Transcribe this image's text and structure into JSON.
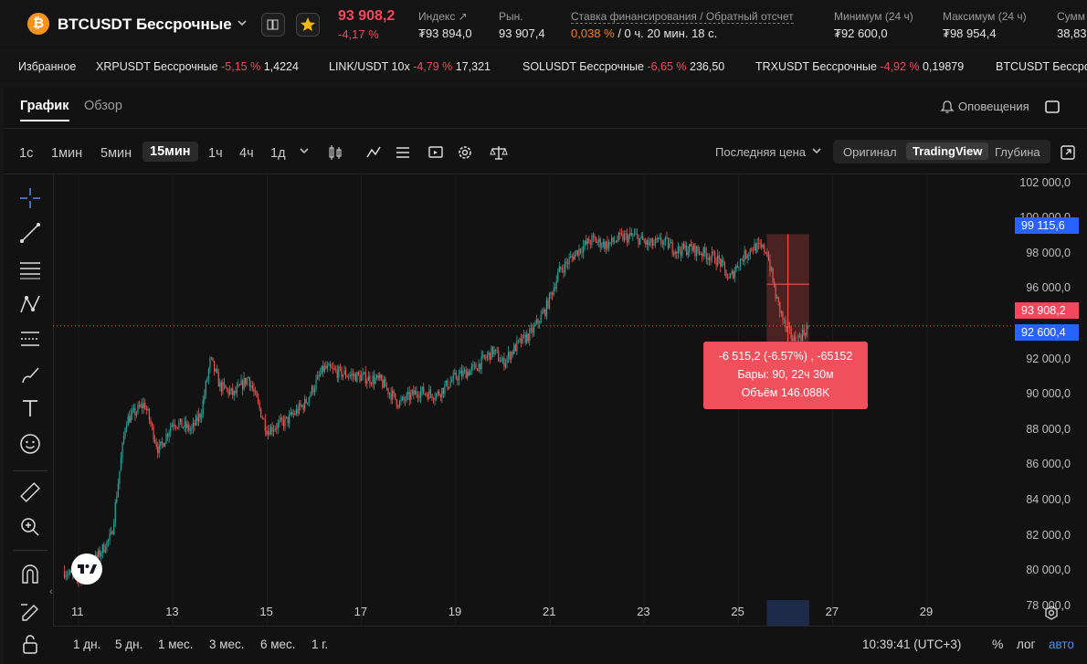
{
  "header": {
    "coin_glyph": "₿",
    "symbol": "BTCUSDT Бессрочные",
    "price": "93 908,2",
    "change": "-4,17 %",
    "index_label": "Индекс",
    "index_value": "₮93 894,0",
    "market_label": "Рын.",
    "market_value": "93 907,4",
    "funding_label": "Ставка финансирования / Обратный отсчет",
    "funding_rate": "0,038 %",
    "funding_countdown": "/ 0 ч. 20 мин. 18 с.",
    "min_label": "Минимум (24 ч)",
    "min_value": "₮92 600,0",
    "max_label": "Максимум (24 ч)",
    "max_value": "₮98 954,4",
    "sum_label": "Сумм",
    "sum_value": "38,83"
  },
  "ticker": {
    "favorites_label": "Избранное",
    "items": [
      {
        "name": "XRPUSDT Бессрочные",
        "change": "-5,15 %",
        "price": "1,4224"
      },
      {
        "name": "LINK/USDT 10x",
        "change": "-4,79 %",
        "price": "17,321"
      },
      {
        "name": "SOLUSDT Бессрочные",
        "change": "-6,65 %",
        "price": "236,50"
      },
      {
        "name": "TRXUSDT Бессрочные",
        "change": "-4,92 %",
        "price": "0,19879"
      },
      {
        "name": "BTCUSDT Бессроч",
        "change": "",
        "price": ""
      }
    ]
  },
  "tabs": {
    "chart": "График",
    "overview": "Обзор",
    "alerts": "Оповещения"
  },
  "toolbar": {
    "intervals": [
      "1с",
      "1мин",
      "5мин",
      "15мин",
      "1ч",
      "4ч",
      "1д"
    ],
    "active_interval": "15мин",
    "price_type": "Последняя цена",
    "views": [
      "Оригинал",
      "TradingView",
      "Глубина"
    ],
    "active_view": "TradingView"
  },
  "bottom": {
    "ranges": [
      "1 дн.",
      "5 дн.",
      "1 мес.",
      "3 мес.",
      "6 мес.",
      "1 г."
    ],
    "time": "10:39:41 (UTC+3)",
    "percent": "%",
    "log": "лог",
    "auto": "авто"
  },
  "colors": {
    "up": "#26a69a",
    "down": "#ef5350",
    "accent": "#f6465d",
    "tag_blue": "#2962ff"
  },
  "chart_data": {
    "type": "candlestick",
    "x_ticks": [
      "11",
      "13",
      "15",
      "17",
      "19",
      "21",
      "23",
      "25",
      "27",
      "29"
    ],
    "y_ticks": [
      "102 000,0",
      "100 000,0",
      "98 000,0",
      "96 000,0",
      "92 000,0",
      "90 000,0",
      "88 000,0",
      "86 000,0",
      "84 000,0",
      "82 000,0",
      "80 000,0",
      "78 000,0"
    ],
    "ylim": [
      76900,
      102500
    ],
    "price_tags": {
      "high": "99 115,6",
      "last": "93 908,2",
      "low": "92 600,4"
    },
    "last_price": 93908.2,
    "measure": {
      "line1": "-6 515,2 (-6.57%) , -65152",
      "line2": "Бары: 90, 22ч 30м",
      "line3": "Объём 146.088K",
      "from_day": 25.6,
      "to_day": 26.5,
      "top": 99115.6,
      "bottom": 92600.4
    },
    "path_days": [
      10.7,
      11.0,
      11.4,
      11.7,
      12.0,
      12.4,
      12.7,
      13.0,
      13.4,
      13.6,
      13.8,
      14.0,
      14.3,
      14.6,
      15.0,
      15.4,
      15.8,
      16.2,
      16.6,
      17.0,
      17.4,
      17.8,
      18.2,
      18.6,
      19.0,
      19.4,
      19.8,
      20.0,
      20.3,
      20.6,
      20.9,
      21.2,
      21.6,
      21.9,
      22.2,
      22.5,
      22.8,
      23.1,
      23.4,
      23.7,
      24.0,
      24.3,
      24.6,
      24.8,
      25.0,
      25.3,
      25.6,
      25.8,
      26.0,
      26.2,
      26.5
    ],
    "path_prices": [
      80000,
      79500,
      80800,
      82000,
      88500,
      89500,
      86800,
      88500,
      88000,
      89000,
      92000,
      90500,
      90000,
      91000,
      88000,
      88500,
      89500,
      91500,
      91200,
      91000,
      90800,
      89500,
      90200,
      90000,
      91000,
      91500,
      92500,
      91800,
      92800,
      93500,
      94800,
      97000,
      98200,
      98800,
      98500,
      98900,
      99000,
      98500,
      98700,
      98200,
      98300,
      98000,
      97600,
      96500,
      97500,
      98400,
      98200,
      95500,
      93800,
      93000,
      93900
    ]
  }
}
